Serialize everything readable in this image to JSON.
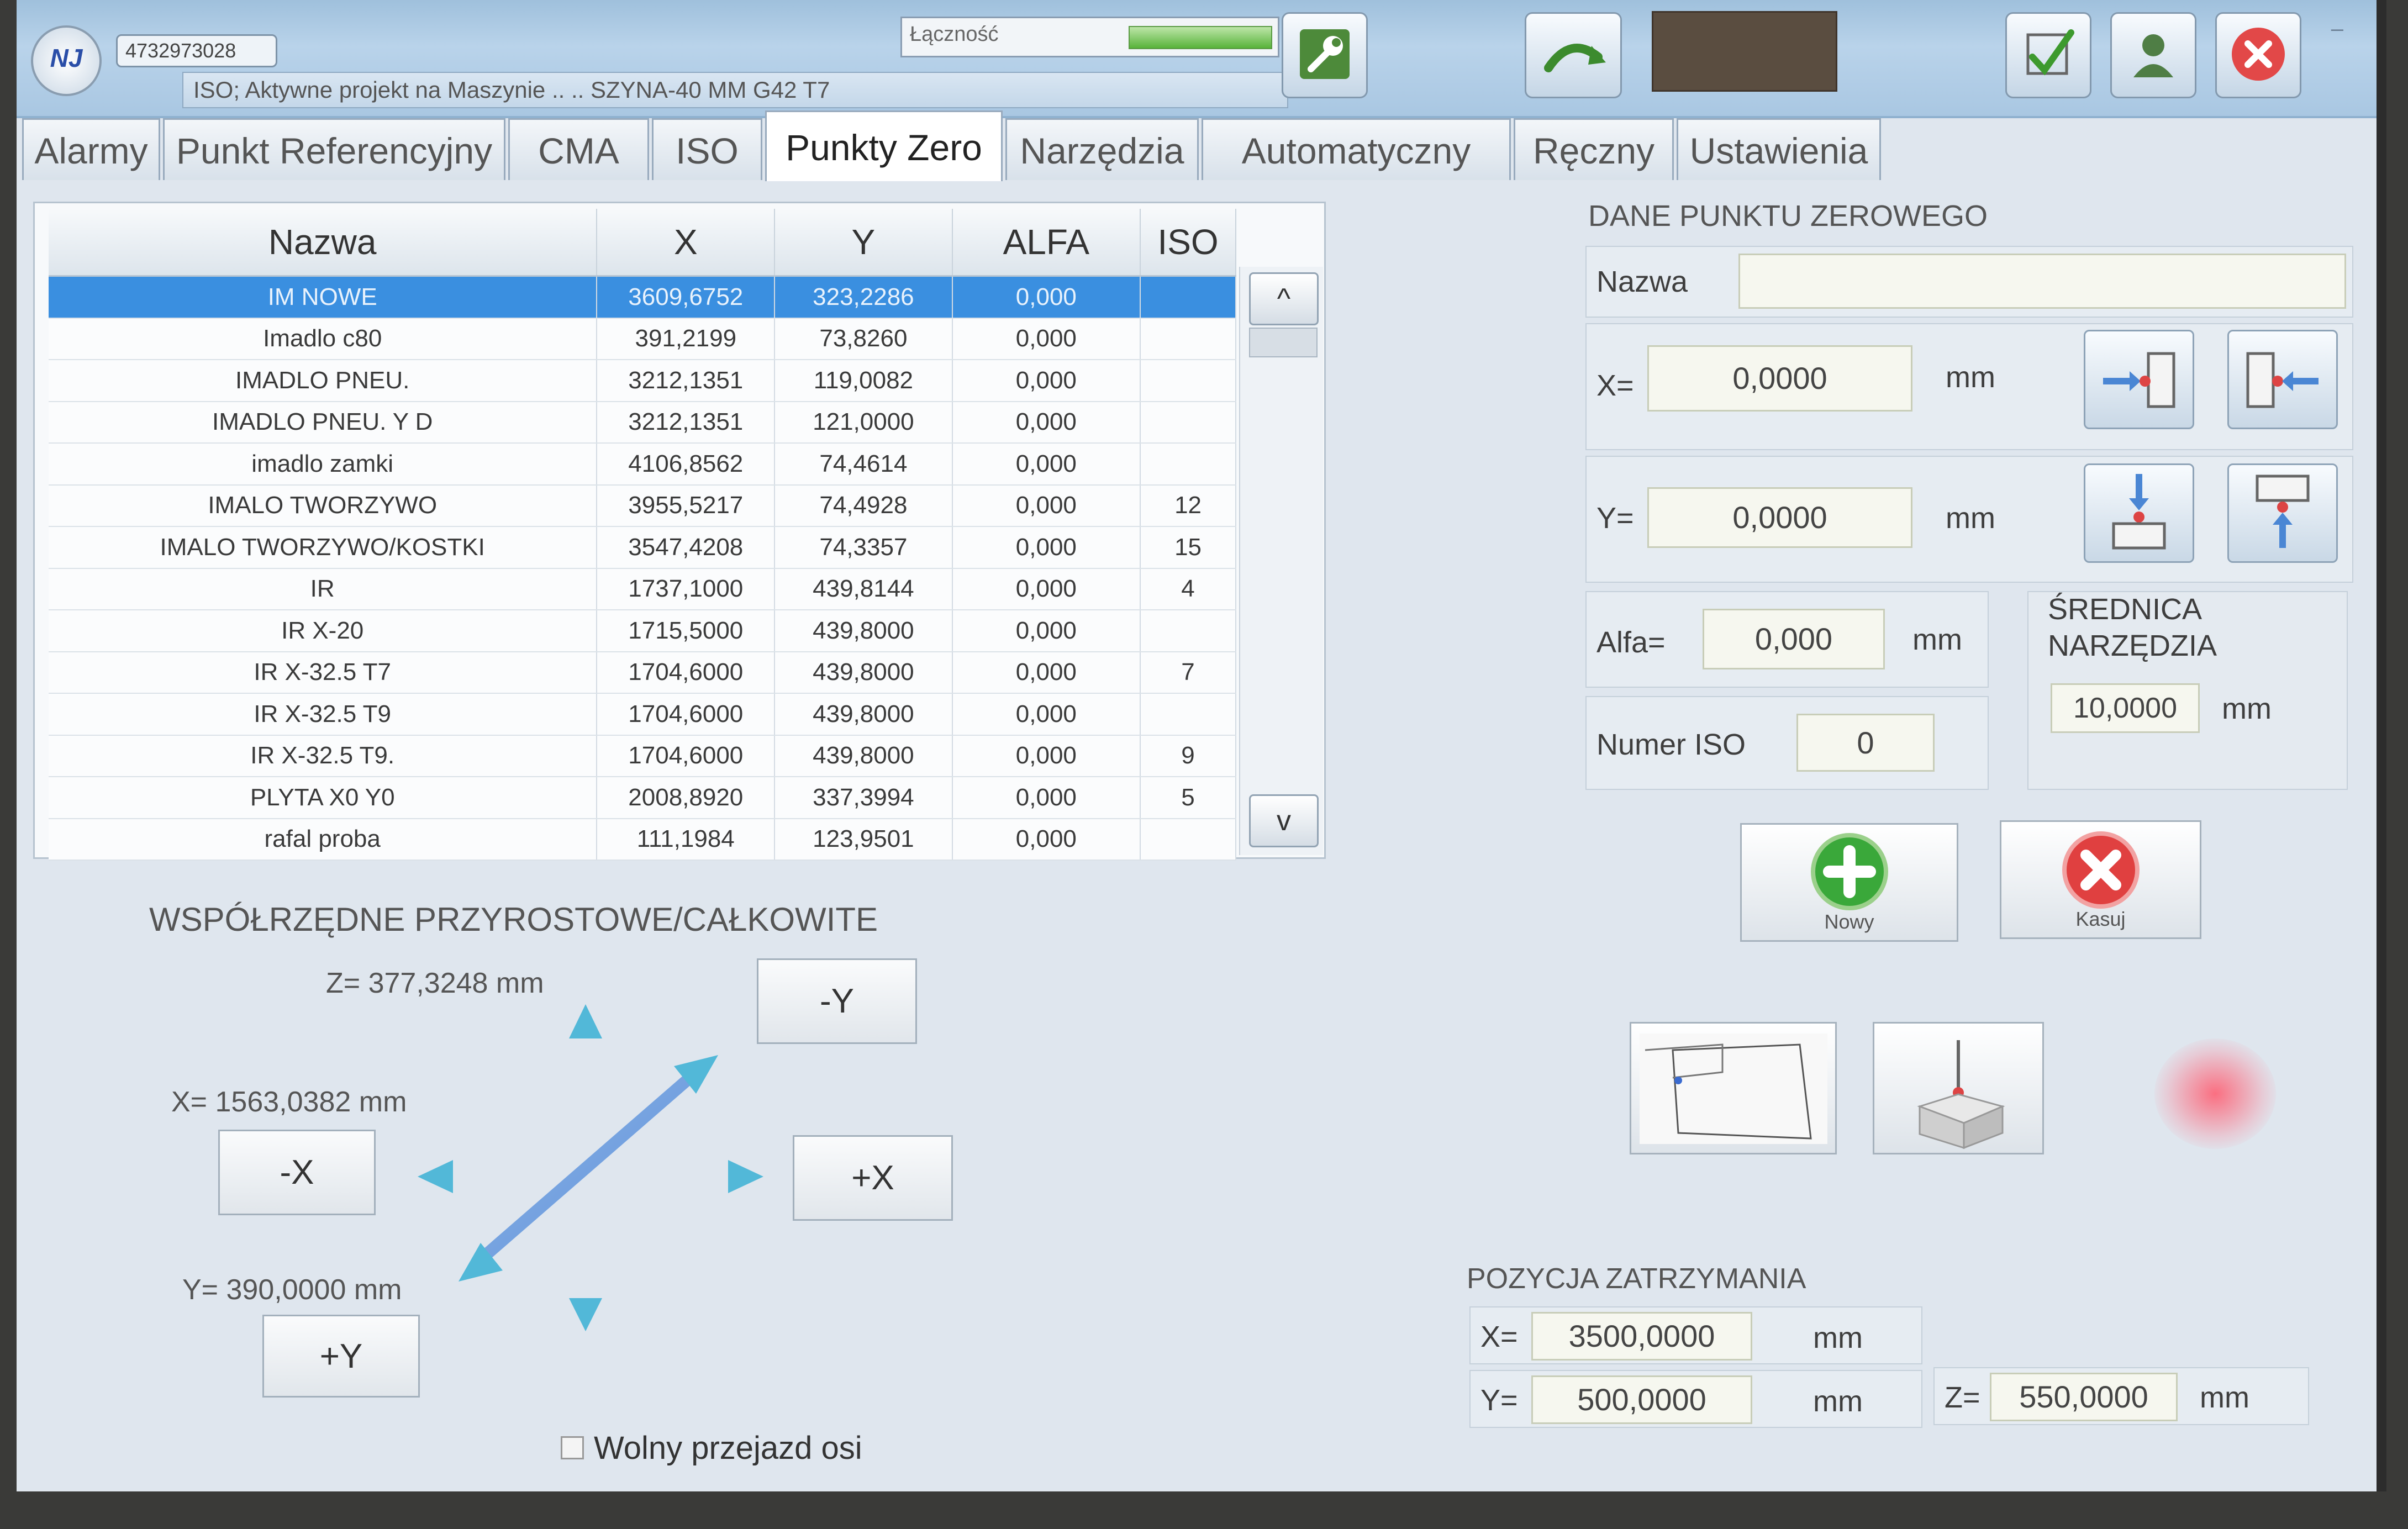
{
  "app": {
    "serial": "4732973028",
    "project_line": "ISO; Aktywne projekt na Maszynie .. .. SZYNA-40 MM G42 T7",
    "connection_label": "Łączność",
    "connection_level": 1.0,
    "icons": [
      "wrench-icon",
      "undo-arrow-icon",
      "checkmark-icon",
      "user-icon",
      "close-icon"
    ]
  },
  "tabs": [
    {
      "label": "Alarmy"
    },
    {
      "label": "Punkt Referencyjny"
    },
    {
      "label": "CMA"
    },
    {
      "label": "ISO"
    },
    {
      "label": "Punkty Zero",
      "active": true
    },
    {
      "label": "Narzędzia"
    },
    {
      "label": "Automatyczny"
    },
    {
      "label": "Ręczny"
    },
    {
      "label": "Ustawienia"
    }
  ],
  "table": {
    "headers": [
      "Nazwa",
      "X",
      "Y",
      "ALFA",
      "ISO"
    ],
    "rows": [
      {
        "name": "IM NOWE",
        "x": "3609,6752",
        "y": "323,2286",
        "alfa": "0,000",
        "iso": "",
        "selected": true
      },
      {
        "name": "Imadlo c80",
        "x": "391,2199",
        "y": "73,8260",
        "alfa": "0,000",
        "iso": ""
      },
      {
        "name": "IMADLO PNEU.",
        "x": "3212,1351",
        "y": "119,0082",
        "alfa": "0,000",
        "iso": ""
      },
      {
        "name": "IMADLO PNEU. Y D",
        "x": "3212,1351",
        "y": "121,0000",
        "alfa": "0,000",
        "iso": ""
      },
      {
        "name": "imadlo zamki",
        "x": "4106,8562",
        "y": "74,4614",
        "alfa": "0,000",
        "iso": ""
      },
      {
        "name": "IMALO TWORZYWO",
        "x": "3955,5217",
        "y": "74,4928",
        "alfa": "0,000",
        "iso": "12"
      },
      {
        "name": "IMALO TWORZYWO/KOSTKI",
        "x": "3547,4208",
        "y": "74,3357",
        "alfa": "0,000",
        "iso": "15"
      },
      {
        "name": "IR",
        "x": "1737,1000",
        "y": "439,8144",
        "alfa": "0,000",
        "iso": "4"
      },
      {
        "name": "IR   X-20",
        "x": "1715,5000",
        "y": "439,8000",
        "alfa": "0,000",
        "iso": ""
      },
      {
        "name": "IR   X-32.5 T7",
        "x": "1704,6000",
        "y": "439,8000",
        "alfa": "0,000",
        "iso": "7"
      },
      {
        "name": "IR   X-32.5 T9",
        "x": "1704,6000",
        "y": "439,8000",
        "alfa": "0,000",
        "iso": ""
      },
      {
        "name": "IR   X-32.5 T9.",
        "x": "1704,6000",
        "y": "439,8000",
        "alfa": "0,000",
        "iso": "9"
      },
      {
        "name": "PLYTA X0 Y0",
        "x": "2008,8920",
        "y": "337,3994",
        "alfa": "0,000",
        "iso": "5"
      },
      {
        "name": "rafal proba",
        "x": "111,1984",
        "y": "123,9501",
        "alfa": "0,000",
        "iso": ""
      }
    ],
    "scroll_up": "^",
    "scroll_down": "v"
  },
  "coords": {
    "title": "WSPÓŁRZĘDNE PRZYROSTOWE/CAŁKOWITE",
    "z_readout": "Z= 377,3248 mm",
    "x_readout": "X= 1563,0382 mm",
    "y_readout": "Y= 390,0000 mm",
    "btn_minus_y": "-Y",
    "btn_minus_x": "-X",
    "btn_plus_x": "+X",
    "btn_plus_y": "+Y",
    "free_move_label": "Wolny przejazd osi",
    "free_move_checked": false
  },
  "zero_point": {
    "title": "DANE PUNKTU ZEROWEGO",
    "name_label": "Nazwa",
    "name_value": "",
    "x_label": "X=",
    "x_value": "0,0000",
    "y_label": "Y=",
    "y_value": "0,0000",
    "alfa_label": "Alfa=",
    "alfa_value": "0,000",
    "unit": "mm",
    "iso_label": "Numer ISO",
    "iso_value": "0",
    "diam_label_1": "ŚREDNICA",
    "diam_label_2": "NARZĘDZIA",
    "diam_value": "10,0000",
    "new_label": "Nowy",
    "delete_label": "Kasuj"
  },
  "stop_position": {
    "title": "POZYCJA ZATRZYMANIA",
    "x_label": "X=",
    "x_value": "3500,0000",
    "y_label": "Y=",
    "y_value": "500,0000",
    "z_label": "Z=",
    "z_value": "550,0000",
    "unit": "mm"
  },
  "colors": {
    "selected_row": "#3a8fe0",
    "add_green": "#3aa83a",
    "delete_red": "#e04040"
  }
}
